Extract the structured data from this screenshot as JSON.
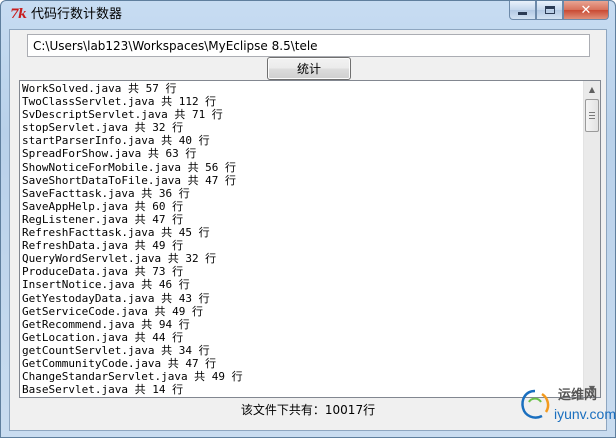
{
  "window": {
    "title": "代码行数计数器",
    "app_icon_glyph": "7k"
  },
  "path_input": {
    "value": "C:\\Users\\lab123\\Workspaces\\MyEclipse 8.5\\tele"
  },
  "count_button": {
    "label": "统计"
  },
  "file_list": [
    "WorkSolved.java 共 57 行",
    "TwoClassServlet.java 共 112 行",
    "SvDescriptServlet.java 共 71 行",
    "stopServlet.java 共 32 行",
    "startParserInfo.java 共 40 行",
    "SpreadForShow.java 共 63 行",
    "ShowNoticeForMobile.java 共 56 行",
    "SaveShortDataToFile.java 共 47 行",
    "SaveFacttask.java 共 36 行",
    "SaveAppHelp.java 共 60 行",
    "RegListener.java 共 47 行",
    "RefreshFacttask.java 共 45 行",
    "RefreshData.java 共 49 行",
    "QueryWordServlet.java 共 32 行",
    "ProduceData.java 共 73 行",
    "InsertNotice.java 共 46 行",
    "GetYestodayData.java 共 43 行",
    "GetServiceCode.java 共 49 行",
    "GetRecommend.java 共 94 行",
    "GetLocation.java 共 44 行",
    "getCountServlet.java 共 34 行",
    "GetCommunityCode.java 共 47 行",
    "ChangeStandarServlet.java 共 49 行",
    "BaseServlet.java 共 14 行"
  ],
  "status": {
    "text": "该文件下共有：10017行"
  },
  "watermark": {
    "cn": "运维网",
    "en": "iyunv.com"
  },
  "icons": {
    "app": "tk-feather-icon",
    "minimize": "minimize-icon",
    "maximize": "maximize-icon",
    "close": "close-icon",
    "scroll_up": "scroll-up-arrow-icon",
    "scroll_down": "scroll-down-arrow-icon"
  },
  "colors": {
    "title_bar": "#b9d1ea",
    "client_bg": "#f0f0f0",
    "close_button": "#c94a33",
    "watermark_blue": "#1a6fbf"
  }
}
